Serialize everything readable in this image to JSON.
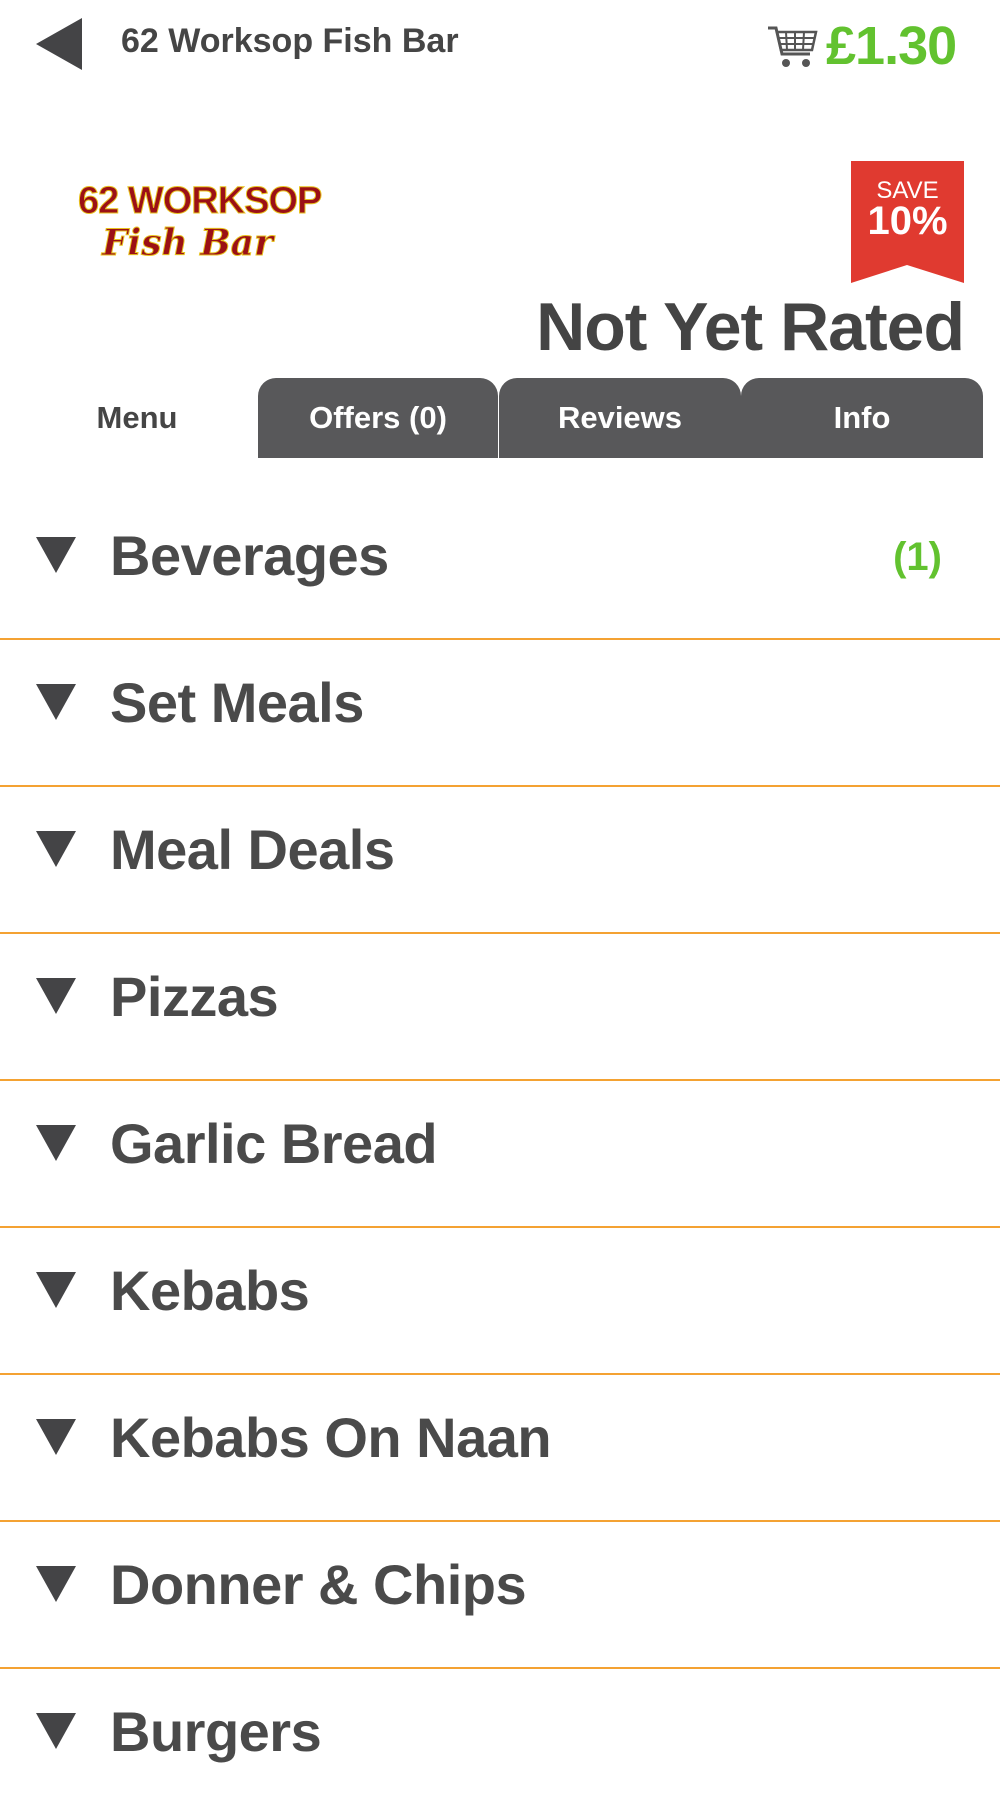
{
  "header": {
    "back_icon": "back-arrow-icon",
    "store_name": "62 Worksop Fish Bar",
    "cart_icon": "shopping-cart-icon",
    "cart_total": "£1.30"
  },
  "logo": {
    "line1": "62 WORKSOP",
    "line2": "Fish Bar"
  },
  "badge": {
    "save_label": "SAVE",
    "save_percent": "10%"
  },
  "rating_text": "Not Yet Rated",
  "tabs": [
    {
      "label": "Menu",
      "active": true
    },
    {
      "label": "Offers (0)",
      "active": false
    },
    {
      "label": "Reviews",
      "active": false
    },
    {
      "label": "Info",
      "active": false
    }
  ],
  "categories": [
    {
      "label": "Beverages",
      "count": "(1)"
    },
    {
      "label": "Set Meals",
      "count": ""
    },
    {
      "label": "Meal Deals",
      "count": ""
    },
    {
      "label": "Pizzas",
      "count": ""
    },
    {
      "label": "Garlic Bread",
      "count": ""
    },
    {
      "label": "Kebabs",
      "count": ""
    },
    {
      "label": "Kebabs On Naan",
      "count": ""
    },
    {
      "label": "Donner & Chips",
      "count": ""
    },
    {
      "label": "Burgers",
      "count": ""
    }
  ],
  "colors": {
    "accent_green": "#62c22f",
    "divider_orange": "#f4a232",
    "tab_dark": "#58585a",
    "badge_red": "#e03a30"
  }
}
